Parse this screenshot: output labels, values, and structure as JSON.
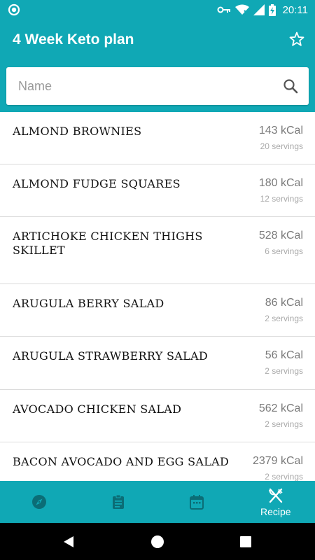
{
  "status_bar": {
    "time": "20:11",
    "icons": [
      "notification-circle-icon",
      "key-icon",
      "wifi-icon",
      "signal-icon",
      "battery-charging-icon"
    ]
  },
  "app_bar": {
    "title": "4 Week Keto plan",
    "action_icon": "star-outline-icon"
  },
  "search": {
    "placeholder": "Name",
    "value": "",
    "icon": "search-icon"
  },
  "recipes": [
    {
      "name": "ALMOND BROWNIES",
      "kcal": "143 kCal",
      "servings": "20 servings"
    },
    {
      "name": "ALMOND FUDGE SQUARES",
      "kcal": "180 kCal",
      "servings": "12 servings"
    },
    {
      "name": "ARTICHOKE CHICKEN THIGHS SKILLET",
      "kcal": "528 kCal",
      "servings": "6 servings"
    },
    {
      "name": "ARUGULA BERRY SALAD",
      "kcal": "86 kCal",
      "servings": "2 servings"
    },
    {
      "name": "ARUGULA STRAWBERRY SALAD",
      "kcal": "56 kCal",
      "servings": "2 servings"
    },
    {
      "name": "AVOCADO CHICKEN SALAD",
      "kcal": "562 kCal",
      "servings": "2 servings"
    },
    {
      "name": "BACON AVOCADO AND EGG SALAD",
      "kcal": "2379 kCal",
      "servings": "2 servings"
    }
  ],
  "bottom_nav": {
    "items": [
      {
        "icon": "compass-icon",
        "label": ""
      },
      {
        "icon": "clipboard-icon",
        "label": ""
      },
      {
        "icon": "calendar-icon",
        "label": ""
      },
      {
        "icon": "fork-knife-icon",
        "label": "Recipe"
      }
    ],
    "active_index": 3
  },
  "system_nav": [
    "back-icon",
    "home-icon",
    "recents-icon"
  ],
  "colors": {
    "primary": "#10a8b5",
    "nav_icon_inactive": "#0b6d76",
    "divider": "#dcdcdc"
  }
}
